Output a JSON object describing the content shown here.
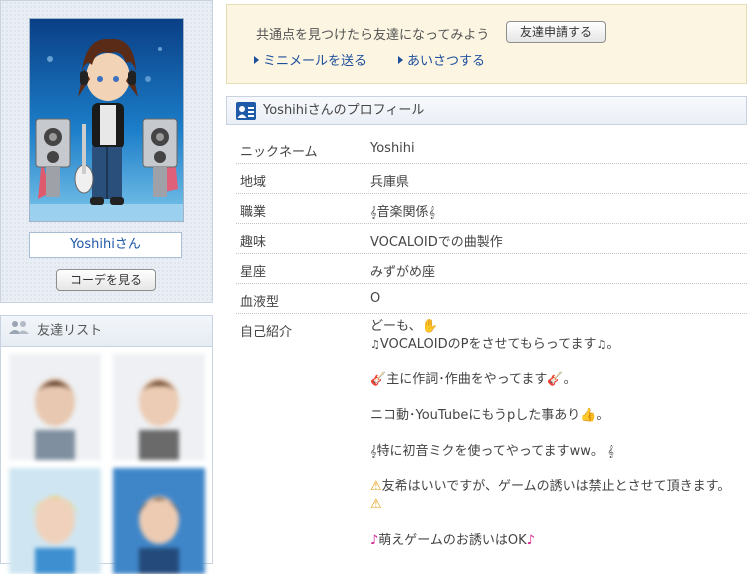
{
  "avatar": {
    "name": "Yoshihiさん",
    "view_coord_button": "コーデを見る"
  },
  "friends": {
    "title": "友達リスト"
  },
  "notice": {
    "text": "共通点を見つけたら友達になってみよう",
    "friend_request_button": "友達申請する",
    "links": [
      "ミニメールを送る",
      "あいさつする"
    ]
  },
  "profile": {
    "heading": "Yoshihiさんのプロフィール",
    "rows": [
      {
        "label": "ニックネーム",
        "value": "Yoshihi"
      },
      {
        "label": "地域",
        "value": "兵庫県"
      },
      {
        "label": "職業",
        "value": "音楽関係"
      },
      {
        "label": "趣味",
        "value": "VOCALOIDでの曲製作"
      },
      {
        "label": "星座",
        "value": "みずがめ座"
      },
      {
        "label": "血液型",
        "value": "O"
      }
    ],
    "intro_label": "自己紹介",
    "intro": {
      "l1": "どーも、",
      "l2": "VOCALOIDのPをさせてもらってます",
      "l2_end": "。",
      "l3": "主に作詞･作曲をやってます",
      "l3_end": "。",
      "l4": "ニコ動･YouTubeにもうpした事あり",
      "l4_end": "。",
      "l5": "特に初音ミクを使ってやってますww。",
      "l6": "友希はいいですが、ゲームの誘いは禁止とさせて頂きます。",
      "l7": "萌えゲームのお誘いはOK"
    }
  },
  "colors": {
    "link": "#1d4e9c",
    "notice_bg": "#fbf5e2",
    "name_text": "#1d57a8"
  }
}
